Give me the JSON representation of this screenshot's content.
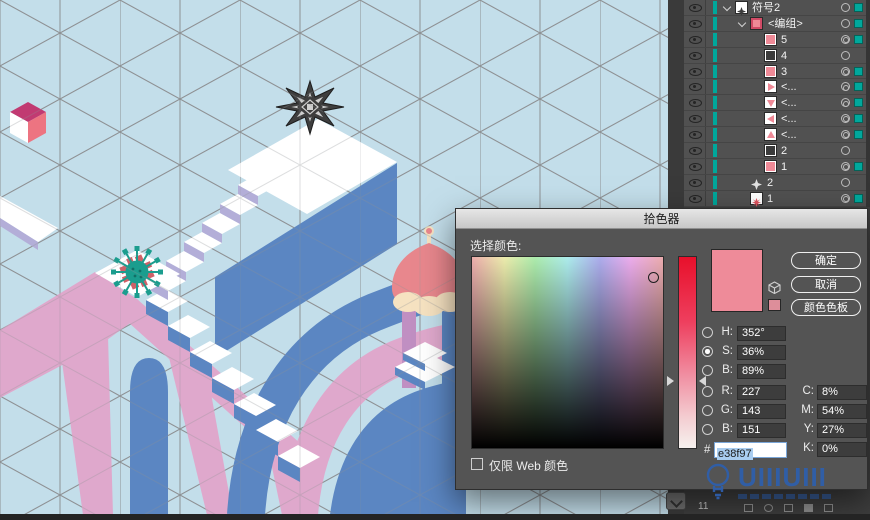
{
  "canvas": {
    "watermark_text": "UIIIUIII",
    "panel_badge": "11",
    "palette": {
      "sky": "#c3deea",
      "grid": "#8e9194",
      "steel_blue": "#5b86c2",
      "pink_structure": "#dfa8cc",
      "dome_salmon": "#e8878d",
      "cream_trim": "#f6e2c1",
      "cube_top": "#c13a72",
      "cube_side": "#ed7481",
      "teal_ornament": "#1b9d8e",
      "lavender_riser": "#b3aed8",
      "star_dark": "#3e3e3e"
    }
  },
  "layers_panel": {
    "rows": [
      {
        "label": "符号2",
        "thumb": "symbol-star"
      },
      {
        "label": "<编组>",
        "thumb": "group"
      },
      {
        "label": "5",
        "thumb": "pink-swatch"
      },
      {
        "label": "4",
        "thumb": "dark-swatch"
      },
      {
        "label": "3",
        "thumb": "pink-swatch"
      },
      {
        "label": "<...",
        "thumb": "triangle-right"
      },
      {
        "label": "<...",
        "thumb": "triangle-down"
      },
      {
        "label": "<...",
        "thumb": "triangle-left"
      },
      {
        "label": "<...",
        "thumb": "triangle-up"
      },
      {
        "label": "2",
        "thumb": "dark-swatch"
      },
      {
        "label": "1",
        "thumb": "pink-swatch"
      },
      {
        "label": "2",
        "thumb": "star-light"
      },
      {
        "label": "1",
        "thumb": "star-red"
      }
    ]
  },
  "dialog": {
    "title": "拾色器",
    "select_color_label": "选择颜色:",
    "buttons": {
      "ok": "确定",
      "cancel": "取消",
      "swatches": "颜色色板"
    },
    "selected_radio": "S",
    "fields": {
      "h": {
        "label": "H:",
        "value": "352°"
      },
      "s": {
        "label": "S:",
        "value": "36%"
      },
      "b": {
        "label": "B:",
        "value": "89%"
      },
      "r": {
        "label": "R:",
        "value": "227"
      },
      "g": {
        "label": "G:",
        "value": "143"
      },
      "b2": {
        "label": "B:",
        "value": "151"
      },
      "c": {
        "label": "C:",
        "value": "8%"
      },
      "m": {
        "label": "M:",
        "value": "54%"
      },
      "y": {
        "label": "Y:",
        "value": "27%"
      },
      "k": {
        "label": "K:",
        "value": "0%"
      },
      "hex": {
        "label": "#",
        "value": "e38f97"
      }
    },
    "current_color": "#ee8b99",
    "web_only_label": "仅限 Web 颜色"
  }
}
